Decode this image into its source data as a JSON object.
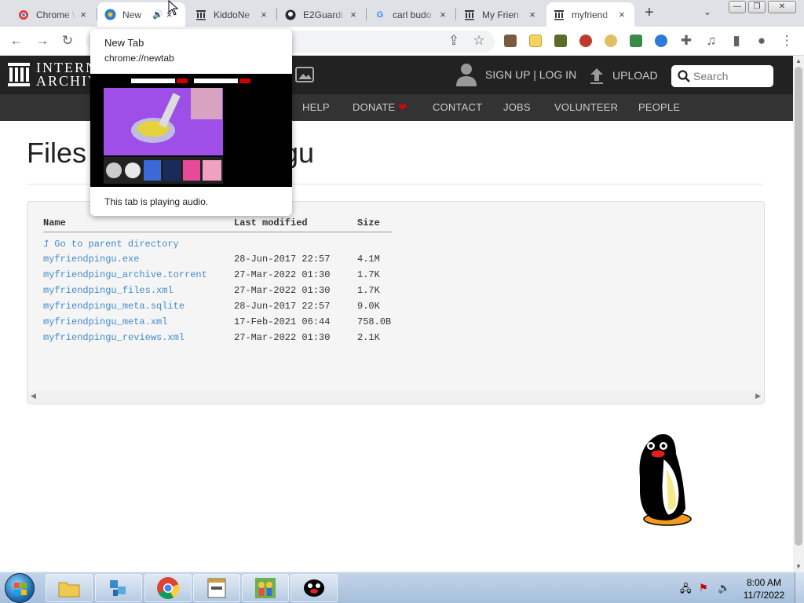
{
  "browser": {
    "tabs": [
      {
        "title": "Chrome \\",
        "active": false
      },
      {
        "title": "New",
        "active": true
      },
      {
        "title": "KiddoNe",
        "active": false
      },
      {
        "title": "E2Guardi",
        "active": false
      },
      {
        "title": "carl budo",
        "active": false
      },
      {
        "title": "My Frien",
        "active": false
      },
      {
        "title": "myfriend",
        "active": false
      }
    ],
    "new_tab_symbol": "+",
    "tab_search_symbol": "⌄",
    "close_symbol": "×"
  },
  "popup": {
    "title": "New Tab",
    "url": "chrome://newtab",
    "status": "This tab is playing audio."
  },
  "ia": {
    "logo_lines": [
      "INTERN",
      "ARCHIV"
    ],
    "signup_label": "SIGN UP | LOG IN",
    "upload_label": "UPLOAD",
    "search_placeholder": "Search",
    "nav": [
      "HELP",
      "DONATE",
      "CONTACT",
      "JOBS",
      "VOLUNTEER",
      "PEOPLE"
    ],
    "heading_left": "Files",
    "heading_right": "gu"
  },
  "listing": {
    "headers": {
      "name": "Name",
      "modified": "Last modified",
      "size": "Size"
    },
    "parent": "Go to parent directory",
    "rows": [
      {
        "name": "myfriendpingu.exe",
        "modified": "28-Jun-2017 22:57",
        "size": "4.1M"
      },
      {
        "name": "myfriendpingu_archive.torrent",
        "modified": "27-Mar-2022 01:30",
        "size": "1.7K"
      },
      {
        "name": "myfriendpingu_files.xml",
        "modified": "27-Mar-2022 01:30",
        "size": "1.7K"
      },
      {
        "name": "myfriendpingu_meta.sqlite",
        "modified": "28-Jun-2017 22:57",
        "size": "9.0K"
      },
      {
        "name": "myfriendpingu_meta.xml",
        "modified": "17-Feb-2021 06:44",
        "size": "758.0B"
      },
      {
        "name": "myfriendpingu_reviews.xml",
        "modified": "27-Mar-2022 01:30",
        "size": "2.1K"
      }
    ]
  },
  "taskbar": {
    "time": "8:00 AM",
    "date": "11/7/2022"
  },
  "colors": {
    "link": "#428bca",
    "ia_dark": "#222222",
    "donate_heart": "#e30000"
  }
}
